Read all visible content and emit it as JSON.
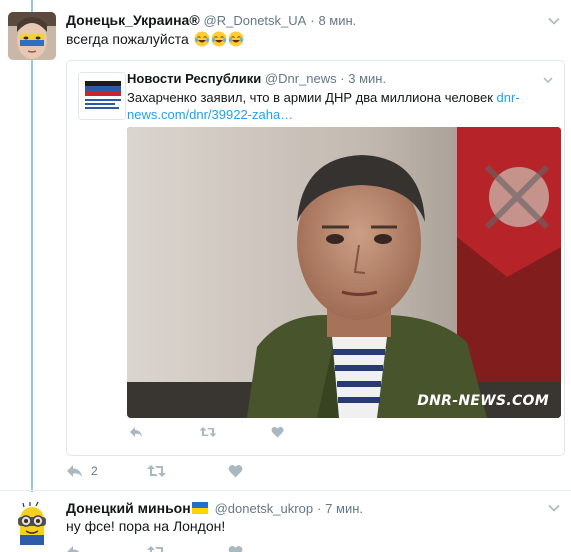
{
  "tweets": [
    {
      "author_name": "Донецьк_Украина®",
      "handle": "@R_Donetsk_UA",
      "time": "8 мин.",
      "text": "всегда пожалуйста",
      "emoji": [
        "face-with-tears-of-joy-emoji",
        "face-with-tears-of-joy-emoji",
        "face-with-tears-of-joy-emoji"
      ],
      "reply_count": "2",
      "quoted": {
        "author_name": "Новости Республики",
        "handle": "@Dnr_news",
        "time": "3 мин.",
        "text": "Захарченко заявил, что в армии ДНР два миллиона человек ",
        "link": "dnr-news.com/dnr/39922-zaha…",
        "avatar_caption": "ДОНЕЦКАЯ НАРОДНАЯ РЕСПУБЛИКА",
        "photo_watermark": "DNR-NEWS.COM"
      }
    },
    {
      "author_name": "Донецкий миньон",
      "name_badge": "ukraine-flag-emoji",
      "handle": "@donetsk_ukrop",
      "time": "7 мин.",
      "text": "ну фсе! пора на Лондон!"
    }
  ],
  "colors": {
    "thread_line": "#8fc8ee",
    "link": "#1da1f2",
    "muted": "#657786",
    "icon": "#aab8c2"
  }
}
